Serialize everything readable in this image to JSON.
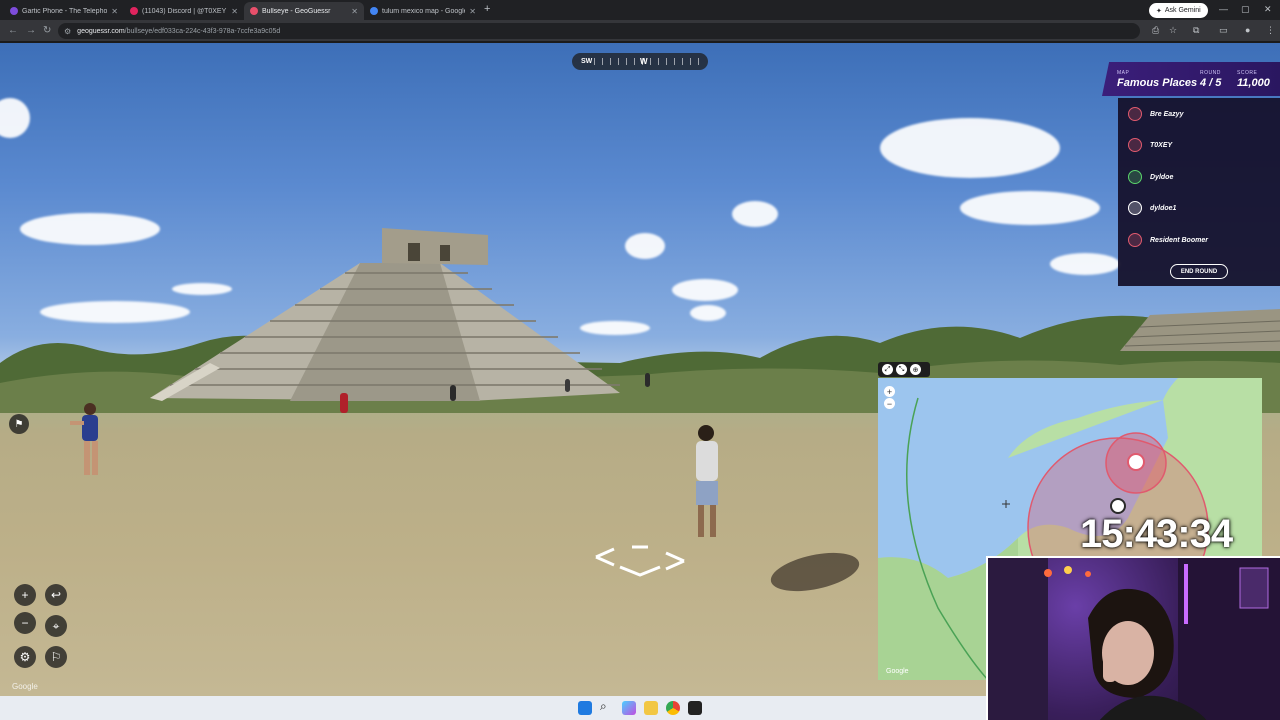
{
  "browser": {
    "tabs": [
      {
        "label": "Gartic Phone - The Telephone G",
        "color": "#7d4cdb"
      },
      {
        "label": "(11043) Discord | @T0XEY",
        "color": "#e0245e"
      },
      {
        "label": "Bullseye - GeoGuessr",
        "color": "#e84f6b"
      },
      {
        "label": "tulum mexico map - Google Se",
        "color": "#4285f4"
      }
    ],
    "new_tab": "+",
    "ask_gemini": "Ask Gemini",
    "url_host": "geoguessr.com",
    "url_path": "/bullseye/edf033ca-224c-43f3-978a-7ccfe3a9c05d"
  },
  "compass": {
    "left": "SW",
    "center": "W"
  },
  "scoreboard": {
    "map_label": "MAP",
    "map_name": "Famous Places",
    "round_label": "ROUND",
    "round_value": "4 / 5",
    "score_label": "SCORE",
    "score_value": "11,000"
  },
  "players": [
    {
      "name": "Bre Eazyy",
      "ring": "#e05a6e"
    },
    {
      "name": "T0XEY",
      "ring": "#e05a6e"
    },
    {
      "name": "Dyldoe",
      "ring": "#5ad36b"
    },
    {
      "name": "dyldoe1",
      "ring": "#ffffff"
    },
    {
      "name": "Resident Boomer",
      "ring": "#e05a6e"
    }
  ],
  "end_round": "END ROUND",
  "timer": "15:43:34",
  "map": {
    "zoom_in": "+",
    "zoom_out": "−",
    "attribution": "Google"
  },
  "street_view": {
    "attribution": "Google"
  },
  "colors": {
    "accent": "#3b1e7a",
    "guess_circle": "#e05a6e",
    "map_water": "#9cc5ee",
    "map_land": "#b8dfa5"
  }
}
